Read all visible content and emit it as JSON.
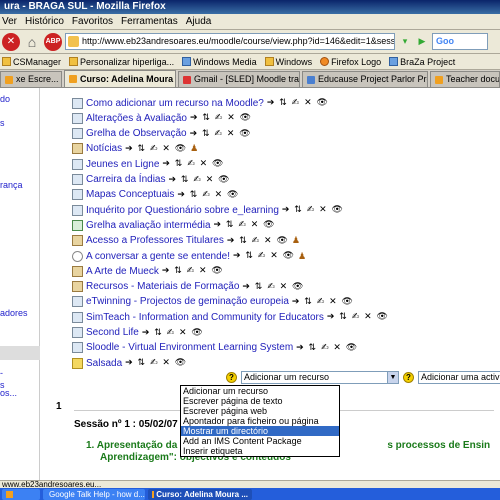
{
  "window": {
    "title": "ura - BRAGA SUL - Mozilla Firefox"
  },
  "menu": [
    "Ver",
    "Histórico",
    "Favoritos",
    "Ferramentas",
    "Ajuda"
  ],
  "nav": {
    "url": "http://www.eb23andresoares.eu/moodle/course/view.php?id=146&edit=1&sesskey=aiA9cuQixc",
    "search_placeholder": "Goo",
    "abp_label": "ABP"
  },
  "bookmarks": [
    "CSManager",
    "Personalizar hiperliga...",
    "Windows Media",
    "Windows",
    "Firefox Logo",
    "BraZa Project"
  ],
  "tabs": [
    {
      "label": "xe Escre...",
      "active": false
    },
    {
      "label": "Curso: Adelina Moura - B...",
      "active": true
    },
    {
      "label": "Gmail - [SLED] Moodle traini...",
      "active": false
    },
    {
      "label": "Educause Project Parlor Pre...",
      "active": false
    },
    {
      "label": "Teacher docu",
      "active": false
    }
  ],
  "left_links": [
    "do",
    "s",
    "rança",
    "adores",
    "-",
    "s",
    "os..."
  ],
  "resources": [
    {
      "label": "Como adicionar um recurso na Moodle?",
      "icon": "document-icon",
      "manual": false
    },
    {
      "label": "Alterações à Avaliação",
      "icon": "document-icon",
      "manual": false
    },
    {
      "label": "Grelha de Observação",
      "icon": "document-icon",
      "manual": false
    },
    {
      "label": "Notícias",
      "icon": "forum-icon",
      "manual": true
    },
    {
      "label": "Jeunes en Ligne",
      "icon": "document-icon",
      "manual": false
    },
    {
      "label": "Carreira da Índias",
      "icon": "document-icon",
      "manual": false
    },
    {
      "label": "Mapas Conceptuais",
      "icon": "document-icon",
      "manual": false
    },
    {
      "label": "Inquérito por Questionário sobre e_learning",
      "icon": "document-icon",
      "manual": false
    },
    {
      "label": "Grelha avaliação intermédia",
      "icon": "wiki-icon",
      "manual": false
    },
    {
      "label": "Acesso a Professores Titulares",
      "icon": "forum-icon",
      "manual": true
    },
    {
      "label": "A conversar a gente se entende!",
      "icon": "chat-icon",
      "manual": true
    },
    {
      "label": "A Arte de Mueck",
      "icon": "forum-icon",
      "manual": false
    },
    {
      "label": "Recursos - Materiais de Formação",
      "icon": "forum-icon",
      "manual": false
    },
    {
      "label": "eTwinning - Projectos de geminação europeia",
      "icon": "document-icon",
      "manual": false
    },
    {
      "label": "SimTeach - Information and Community for Educators",
      "icon": "document-icon",
      "manual": false
    },
    {
      "label": "Second Life",
      "icon": "document-icon",
      "manual": false
    },
    {
      "label": "Sloodle - Virtual Environment Learning System",
      "icon": "document-icon",
      "manual": false
    },
    {
      "label": "Salsada",
      "icon": "folder-icon",
      "manual": false
    }
  ],
  "actions_glyphs": "➔ ⇅ ✍ ✕ 👁",
  "manual_glyph": "♟",
  "add_resource": {
    "select_value": "Adicionar um recurso",
    "activity_value": "Adicionar uma activi",
    "help_label": "?",
    "options": [
      "Adicionar um recurso",
      "Escrever página de texto",
      "Escrever página web",
      "Apontador para ficheiro ou página",
      "Mostrar um directório",
      "Add an IMS Content Package",
      "Inserir etiqueta"
    ],
    "highlighted_index": 4
  },
  "section": {
    "number": "1",
    "session_title": "Sessão nº 1 : 05/02/07",
    "body_prefix": "1.  Apresentação da Oficina de F",
    "body_suffix": "s processos de Ensin",
    "body_line2": "Aprendizagem\": objectivos e conteúdos"
  },
  "status": {
    "text": "www.eb23andresoares.eu..."
  },
  "taskbar": [
    {
      "label": "",
      "active": false
    },
    {
      "label": "Google Talk Help - how d...",
      "active": false
    },
    {
      "label": "Curso: Adelina Moura ...",
      "active": true
    }
  ]
}
